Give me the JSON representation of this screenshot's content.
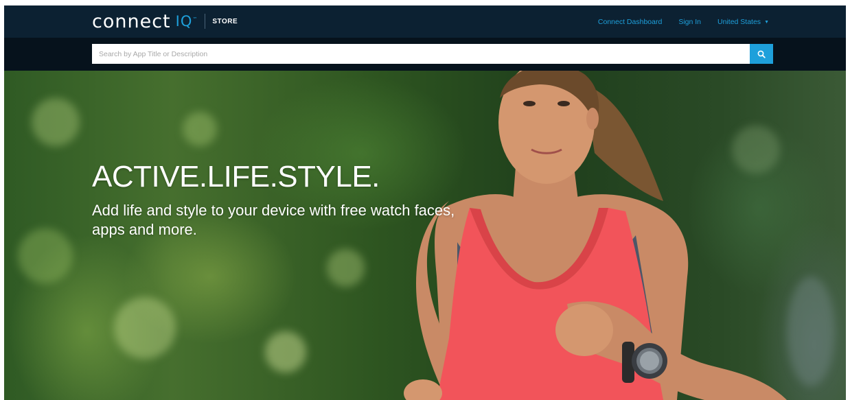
{
  "header": {
    "logo_word": "connect",
    "logo_iq": "IQ",
    "logo_tm": "™",
    "store_label": "STORE",
    "nav": {
      "dashboard": "Connect Dashboard",
      "sign_in": "Sign In",
      "region": "United States"
    }
  },
  "search": {
    "placeholder": "Search by App Title or Description",
    "value": ""
  },
  "hero": {
    "title": "ACTIVE.LIFE.STYLE.",
    "subtitle": "Add life and style to your device with free watch faces, apps and more."
  },
  "icons": {
    "search": "search-icon",
    "caret": "caret-down-icon"
  },
  "colors": {
    "accent": "#1ea0db",
    "topbar": "#0c2132",
    "searchbar": "#06121c",
    "tank_top": "#f2545a"
  }
}
